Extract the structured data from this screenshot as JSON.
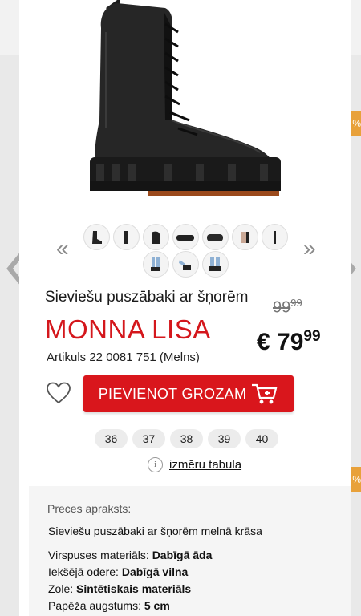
{
  "product": {
    "title": "Sieviešu puszābaki ar šņorēm",
    "brand": "MONNA LISA",
    "sku": "Artikuls 22 0081 751 (Melns)",
    "old_price": {
      "int": "99",
      "dec": "99"
    },
    "price": {
      "int": "€ 79",
      "dec": "99"
    },
    "accent_color": "#d9161c"
  },
  "gallery": {
    "thumbnail_count_row1": 7,
    "thumbnail_count_row2": 3
  },
  "actions": {
    "add_to_cart_label": "PIEVIENOT GROZAM",
    "cart_icon": "cart-plus-icon",
    "wishlist_icon": "heart-icon"
  },
  "sizes": [
    "36",
    "37",
    "38",
    "39",
    "40"
  ],
  "size_table": {
    "label": "izmēru tabula",
    "icon": "info-icon"
  },
  "description": {
    "label": "Preces apraksts:",
    "summary": "Sieviešu puszābaki ar šņorēm melnā krāsa",
    "specs": [
      {
        "key": "Virspuses materiāls:",
        "value": "Dabīgā āda"
      },
      {
        "key": "Iekšējā odere:",
        "value": "Dabīgā vilna"
      },
      {
        "key": "Zole:",
        "value": "Sintētiskais materiāls"
      },
      {
        "key": "Papēža augstums:",
        "value": "5 cm"
      }
    ]
  }
}
